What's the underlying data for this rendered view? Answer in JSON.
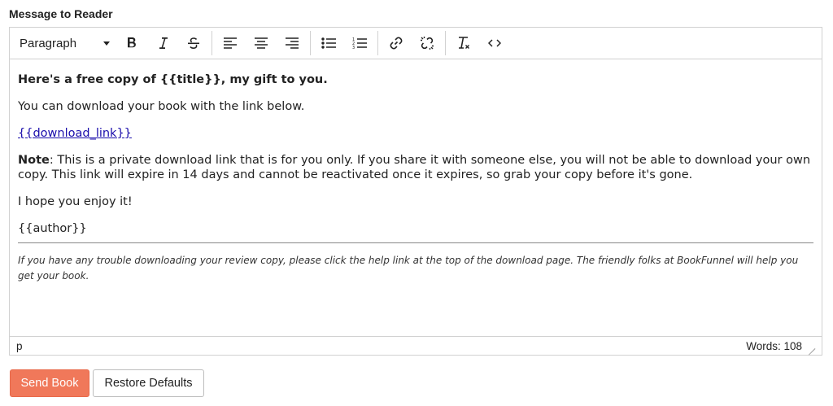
{
  "field_label": "Message to Reader",
  "toolbar": {
    "block_format": "Paragraph",
    "buttons": [
      {
        "name": "bold",
        "icon": "bold-icon"
      },
      {
        "name": "italic",
        "icon": "italic-icon"
      },
      {
        "name": "strikethrough",
        "icon": "strikethrough-icon"
      },
      {
        "name": "align-left",
        "icon": "align-left-icon"
      },
      {
        "name": "align-center",
        "icon": "align-center-icon"
      },
      {
        "name": "align-right",
        "icon": "align-right-icon"
      },
      {
        "name": "bullet-list",
        "icon": "bullet-list-icon"
      },
      {
        "name": "numbered-list",
        "icon": "numbered-list-icon"
      },
      {
        "name": "insert-link",
        "icon": "link-icon"
      },
      {
        "name": "remove-link",
        "icon": "unlink-icon"
      },
      {
        "name": "clear-formatting",
        "icon": "clear-format-icon"
      },
      {
        "name": "source-code",
        "icon": "code-icon"
      }
    ]
  },
  "content": {
    "heading": "Here's a free copy of {{title}}, my gift to you.",
    "line1": "You can download your book with the link below.",
    "link": "{{download_link}}",
    "note_label": "Note",
    "note_text": ": This is a private download link that is for you only. If you share it with someone else, you will not be able to download your own copy. This link will expire in 14 days and cannot be reactivated once it expires, so grab your copy before it's gone.",
    "closing": "I hope you enjoy it!",
    "signature": "{{author}}",
    "footer_note": "If you have any trouble downloading your review copy, please click the help link at the top of the download page. The friendly folks at BookFunnel will help you get your book."
  },
  "statusbar": {
    "path": "p",
    "word_count": "Words: 108"
  },
  "buttons": {
    "send": "Send Book",
    "restore": "Restore Defaults"
  },
  "colors": {
    "primary_button": "#f0785a",
    "link": "#1a0dab"
  }
}
